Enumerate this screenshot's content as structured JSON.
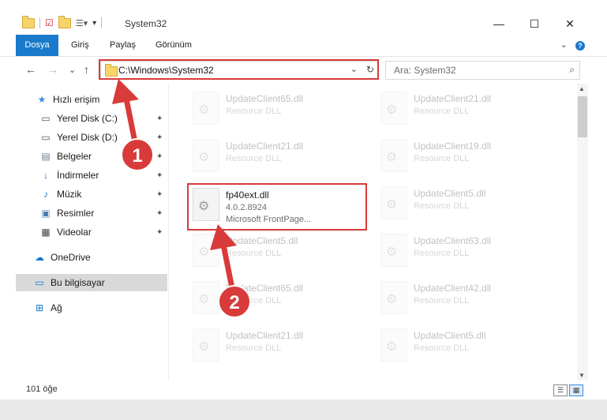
{
  "window": {
    "title": "System32",
    "minimize": "—",
    "maximize": "☐",
    "close": "✕"
  },
  "ribbon": {
    "tabs": [
      "Dosya",
      "Giriş",
      "Paylaş",
      "Görünüm"
    ],
    "collapse": "⌄",
    "help": "?"
  },
  "nav": {
    "back": "←",
    "forward": "→",
    "recent": "⌄",
    "up": "↑",
    "address": "C:\\Windows\\System32",
    "address_dropdown": "⌄",
    "refresh": "↻",
    "search_placeholder": "Ara: System32",
    "search_icon": "⌕"
  },
  "sidebar": {
    "items": [
      {
        "label": "Hızlı erişim",
        "icon": "★",
        "pinned": false
      },
      {
        "label": "Yerel Disk (C:)",
        "icon": "▭",
        "pinned": true
      },
      {
        "label": "Yerel Disk (D:)",
        "icon": "▭",
        "pinned": true
      },
      {
        "label": "Belgeler",
        "icon": "▤",
        "pinned": true
      },
      {
        "label": "İndirmeler",
        "icon": "↓",
        "pinned": true
      },
      {
        "label": "Müzik",
        "icon": "♪",
        "pinned": true
      },
      {
        "label": "Resimler",
        "icon": "▣",
        "pinned": true
      },
      {
        "label": "Videolar",
        "icon": "▦",
        "pinned": true
      },
      {
        "label": "OneDrive",
        "icon": "☁",
        "pinned": false
      },
      {
        "label": "Bu bilgisayar",
        "icon": "▭",
        "pinned": false
      },
      {
        "label": "Ağ",
        "icon": "⊞",
        "pinned": false
      }
    ],
    "pin_glyph": "📌"
  },
  "files": {
    "highlighted": {
      "name": "fp40ext.dll",
      "version": "4.0.2.8924",
      "description": "Microsoft FrontPage..."
    },
    "faded_left": [
      {
        "name": "UpdateClient65.dll",
        "sub": "Resource DLL"
      },
      {
        "name": "UpdateClient21.dll",
        "sub": "Resource DLL"
      },
      {
        "name": "UpdateClient5.dll",
        "sub": "Resource DLL"
      },
      {
        "name": "UpdateClient65.dll",
        "sub": "Resource DLL"
      },
      {
        "name": "UpdateClient21.dll",
        "sub": "Resource DLL"
      }
    ],
    "faded_right": [
      {
        "name": "UpdateClient21.dll",
        "sub": "Resource DLL"
      },
      {
        "name": "UpdateClient19.dll",
        "sub": "Resource DLL"
      },
      {
        "name": "UpdateClient5.dll",
        "sub": "Resource DLL"
      },
      {
        "name": "UpdateClient63.dll",
        "sub": "Resource DLL"
      },
      {
        "name": "UpdateClient42.dll",
        "sub": "Resource DLL"
      },
      {
        "name": "UpdateClient5.dll",
        "sub": "Resource DLL"
      }
    ]
  },
  "annotations": {
    "step1": "1",
    "step2": "2",
    "color": "#d93a3a"
  },
  "status": {
    "count": "101 öğe"
  }
}
